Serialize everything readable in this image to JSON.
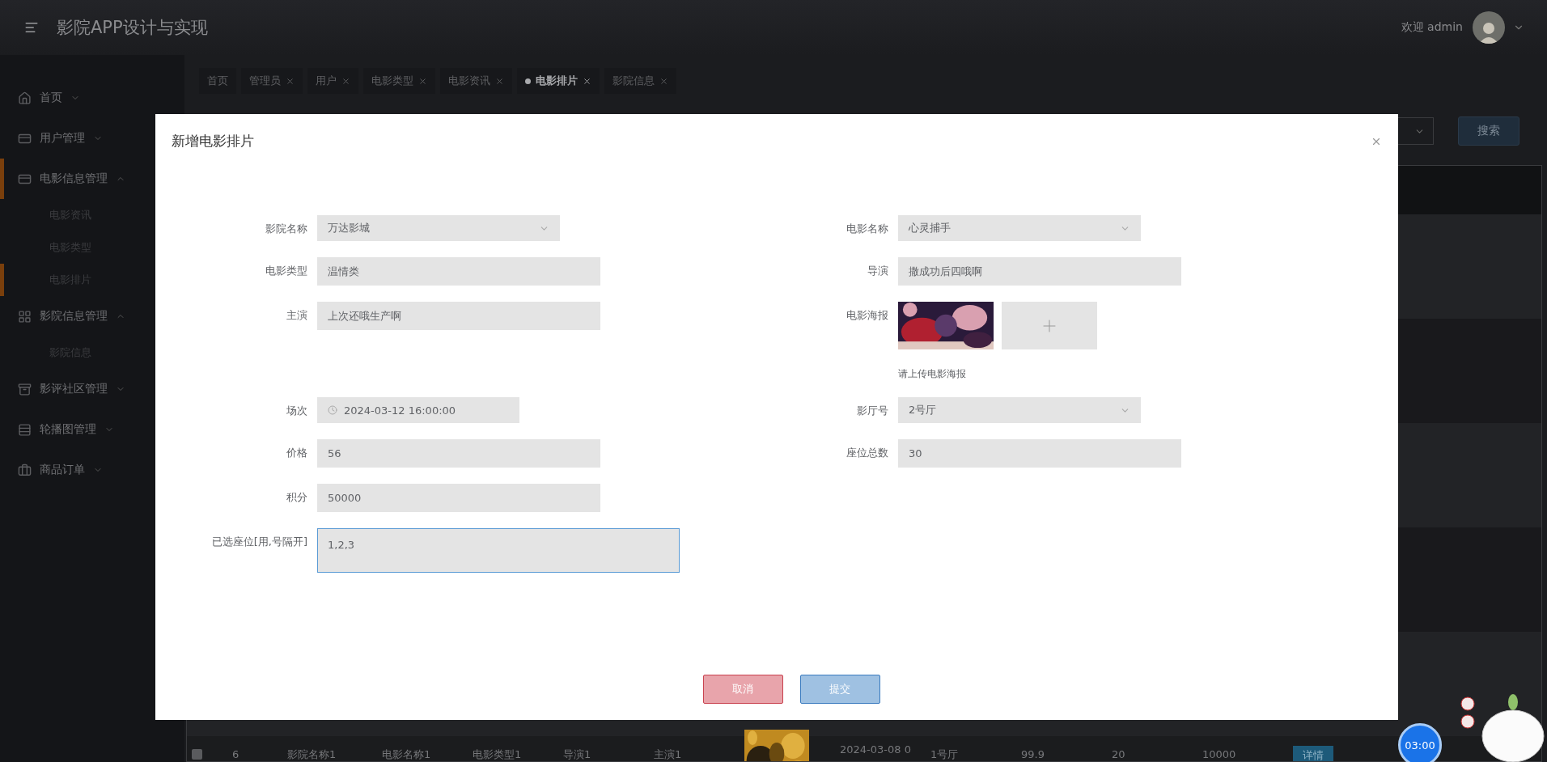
{
  "header": {
    "title": "影院APP设计与实现",
    "greeting": "欢迎 admin"
  },
  "sidebar": {
    "items": [
      {
        "label": "首页",
        "expanded": false,
        "selected": false
      },
      {
        "label": "用户管理",
        "expanded": false,
        "selected": false
      },
      {
        "label": "电影信息管理",
        "expanded": true,
        "selected": true,
        "children": [
          {
            "label": "电影资讯",
            "selected": false
          },
          {
            "label": "电影类型",
            "selected": false
          },
          {
            "label": "电影排片",
            "selected": true
          }
        ]
      },
      {
        "label": "影院信息管理",
        "expanded": true,
        "selected": false,
        "children": [
          {
            "label": "影院信息",
            "selected": false
          }
        ]
      },
      {
        "label": "影评社区管理",
        "expanded": false,
        "selected": false
      },
      {
        "label": "轮播图管理",
        "expanded": false,
        "selected": false
      },
      {
        "label": "商品订单",
        "expanded": false,
        "selected": false
      }
    ]
  },
  "tabs": [
    {
      "label": "首页",
      "selected": false,
      "closable": false
    },
    {
      "label": "管理员",
      "selected": false,
      "closable": true
    },
    {
      "label": "用户",
      "selected": false,
      "closable": true
    },
    {
      "label": "电影类型",
      "selected": false,
      "closable": true
    },
    {
      "label": "电影资讯",
      "selected": false,
      "closable": true
    },
    {
      "label": "电影排片",
      "selected": true,
      "closable": true
    },
    {
      "label": "影院信息",
      "selected": false,
      "closable": true
    }
  ],
  "toolbar": {
    "search_button": "搜索"
  },
  "table": {
    "rows": [
      {
        "checked": false,
        "cells": [
          "6",
          "影院名称1",
          "电影名称1",
          "电影类型1",
          "导演1",
          "主演1",
          {
            "kind": "picture"
          },
          "2024-03-08 0",
          "1号厅",
          "99.9",
          "20",
          "10000"
        ],
        "action": "详情"
      }
    ]
  },
  "dialog": {
    "title": "新增电影排片",
    "form_rows": [
      [
        {
          "kind": "select",
          "label": "影院名称",
          "value": "万达影城"
        },
        {
          "kind": "select",
          "label": "电影名称",
          "value": "心灵捕手"
        }
      ],
      [
        {
          "kind": "input",
          "label": "电影类型",
          "value": "温情类"
        },
        {
          "kind": "input",
          "label": "导演",
          "value": "撒成功后四哦啊"
        }
      ],
      [
        {
          "kind": "input",
          "label": "主演",
          "value": "上次还哦生产啊"
        },
        {
          "kind": "upload",
          "label": "电影海报",
          "hint": "请上传电影海报"
        }
      ],
      [
        {
          "kind": "datetime",
          "label": "场次",
          "value": "2024-03-12 16:00:00"
        },
        {
          "kind": "select",
          "label": "影厅号",
          "value": "2号厅"
        }
      ],
      [
        {
          "kind": "input",
          "label": "价格",
          "value": "56"
        },
        {
          "kind": "input",
          "label": "座位总数",
          "value": "30"
        }
      ],
      [
        {
          "kind": "input",
          "label": "积分",
          "value": "50000"
        }
      ],
      [
        {
          "kind": "textarea",
          "label": "已选座位[用,号隔开]",
          "value": "1,2,3",
          "focused": true
        }
      ]
    ],
    "buttons": [
      {
        "kind": "cancel",
        "label": "取消"
      },
      {
        "kind": "submit",
        "label": "提交"
      }
    ]
  },
  "timer": "03:00"
}
